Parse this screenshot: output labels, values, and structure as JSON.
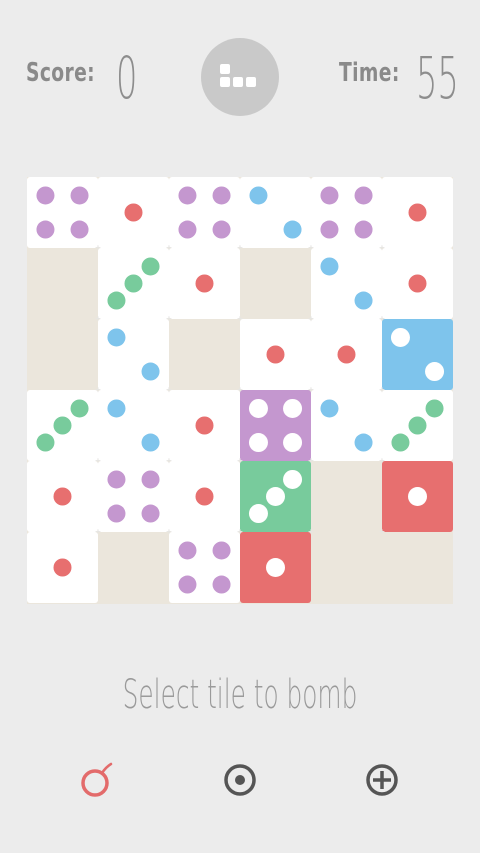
{
  "hud": {
    "score_label": "Score:",
    "score_value": "0",
    "time_label": "Time:",
    "time_value": "55"
  },
  "status_text": "Select tile to bomb",
  "colors": {
    "background": "#ececec",
    "empty_cell": "#ebe6dc",
    "tile": "#ffffff",
    "purple": "#c497cf",
    "red": "#e76f6f",
    "green": "#78cb9c",
    "blue": "#7ec4ec",
    "hud_text": "#8a8a8a",
    "bomb_icon": "#e36b6b",
    "tool_icon": "#555555"
  },
  "board": {
    "rows": 6,
    "cols": 6,
    "cells": [
      [
        {
          "v": 4,
          "c": "purple",
          "filled": false
        },
        {
          "v": 1,
          "c": "red",
          "filled": false
        },
        {
          "v": 4,
          "c": "purple",
          "filled": false
        },
        {
          "v": 2,
          "c": "blue",
          "filled": false
        },
        {
          "v": 4,
          "c": "purple",
          "filled": false
        },
        {
          "v": 1,
          "c": "red",
          "filled": false
        }
      ],
      [
        null,
        {
          "v": 3,
          "c": "green",
          "filled": false
        },
        {
          "v": 1,
          "c": "red",
          "filled": false
        },
        null,
        {
          "v": 2,
          "c": "blue",
          "filled": false
        },
        {
          "v": 1,
          "c": "red",
          "filled": false
        }
      ],
      [
        null,
        {
          "v": 2,
          "c": "blue",
          "filled": false
        },
        null,
        {
          "v": 1,
          "c": "red",
          "filled": false
        },
        {
          "v": 1,
          "c": "red",
          "filled": false
        },
        {
          "v": 2,
          "c": "blue",
          "filled": true
        }
      ],
      [
        {
          "v": 3,
          "c": "green",
          "filled": false
        },
        {
          "v": 2,
          "c": "blue",
          "filled": false
        },
        {
          "v": 1,
          "c": "red",
          "filled": false
        },
        {
          "v": 4,
          "c": "purple",
          "filled": true
        },
        {
          "v": 2,
          "c": "blue",
          "filled": false
        },
        {
          "v": 3,
          "c": "green",
          "filled": false
        }
      ],
      [
        {
          "v": 1,
          "c": "red",
          "filled": false
        },
        {
          "v": 4,
          "c": "purple",
          "filled": false
        },
        {
          "v": 1,
          "c": "red",
          "filled": false
        },
        {
          "v": 3,
          "c": "green",
          "filled": true
        },
        null,
        {
          "v": 1,
          "c": "red",
          "filled": true
        }
      ],
      [
        {
          "v": 1,
          "c": "red",
          "filled": false
        },
        null,
        {
          "v": 4,
          "c": "purple",
          "filled": false
        },
        {
          "v": 1,
          "c": "red",
          "filled": true
        },
        null,
        null
      ]
    ]
  },
  "tools": [
    {
      "name": "bomb-icon"
    },
    {
      "name": "target-icon"
    },
    {
      "name": "add-circle-icon"
    }
  ]
}
